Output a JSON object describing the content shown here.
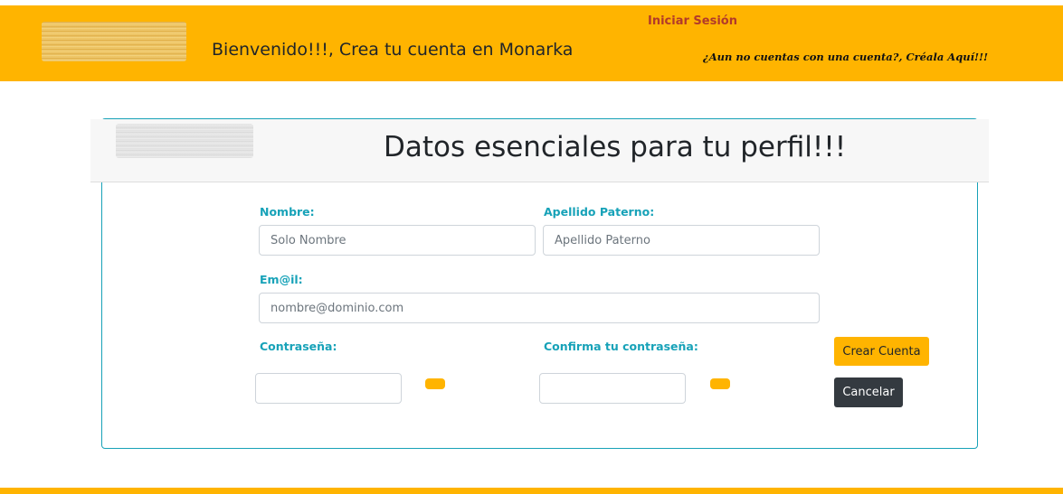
{
  "header": {
    "welcome_text": "Bienvenido!!!, Crea tu cuenta en Monarka",
    "login_link": "Iniciar Sesión",
    "signup_link": "¿Aun no cuentas con una cuenta?, Créala Aquí!!!"
  },
  "card": {
    "title": "Datos esenciales para tu perfil!!!"
  },
  "form": {
    "nombre_label": "Nombre:",
    "nombre_placeholder": "Solo Nombre",
    "apellido_label": "Apellido Paterno:",
    "apellido_placeholder": "Apellido Paterno",
    "email_label": "Em@il:",
    "email_placeholder": "nombre@dominio.com",
    "password_label": "Contraseña:",
    "confirm_label": "Confirma tu contraseña:",
    "create_button": "Crear Cuenta",
    "cancel_button": "Cancelar"
  },
  "colors": {
    "brand_yellow": "#ffb400",
    "label_teal": "#17a2b8",
    "dark_button": "#343a40"
  }
}
